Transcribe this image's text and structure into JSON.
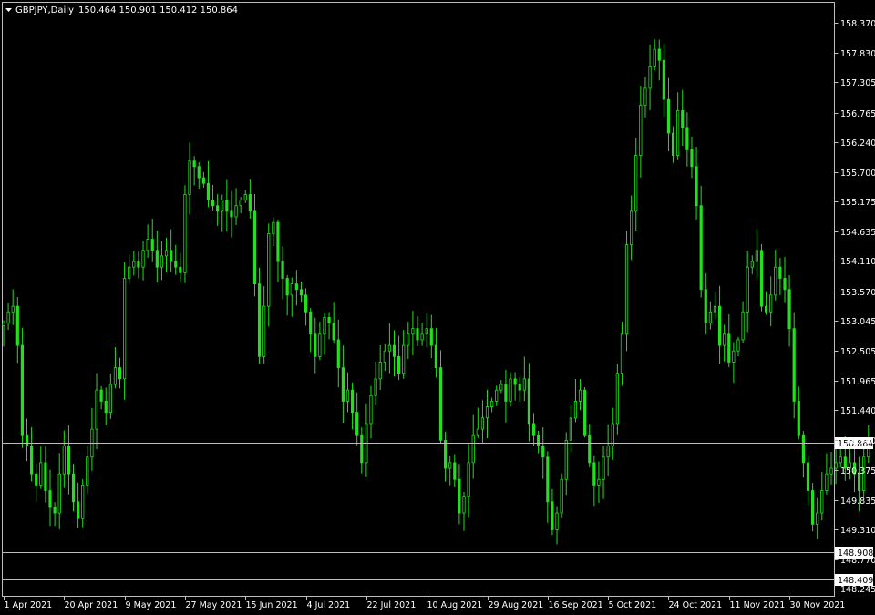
{
  "chart_data": {
    "type": "candlestick",
    "header": {
      "symbol": "GBPJPY,Daily",
      "ohlc": "150.464 150.901 150.412 150.864"
    },
    "ylim": [
      148.15,
      158.65
    ],
    "y_ticks": [
      "158.370",
      "157.830",
      "157.305",
      "156.765",
      "156.240",
      "155.700",
      "155.175",
      "154.635",
      "154.110",
      "153.570",
      "153.045",
      "152.505",
      "151.965",
      "151.440",
      "150.900",
      "150.375",
      "149.835",
      "149.310",
      "148.770",
      "148.245"
    ],
    "x_ticks": [
      {
        "label": "1 Apr 2021",
        "bar": 0
      },
      {
        "label": "20 Apr 2021",
        "bar": 13
      },
      {
        "label": "9 May 2021",
        "bar": 26
      },
      {
        "label": "27 May 2021",
        "bar": 39
      },
      {
        "label": "15 Jun 2021",
        "bar": 52
      },
      {
        "label": "4 Jul 2021",
        "bar": 65
      },
      {
        "label": "22 Jul 2021",
        "bar": 78
      },
      {
        "label": "10 Aug 2021",
        "bar": 91
      },
      {
        "label": "29 Aug 2021",
        "bar": 104
      },
      {
        "label": "16 Sep 2021",
        "bar": 117
      },
      {
        "label": "5 Oct 2021",
        "bar": 130
      },
      {
        "label": "24 Oct 2021",
        "bar": 143
      },
      {
        "label": "11 Nov 2021",
        "bar": 156
      },
      {
        "label": "30 Nov 2021",
        "bar": 169
      }
    ],
    "bar_count": 179,
    "horizontal_lines": [
      {
        "value": 150.864,
        "label": "150.864",
        "color": "#bdbdbd"
      },
      {
        "value": 148.908,
        "label": "148.908",
        "color": "#bdbdbd"
      },
      {
        "value": 148.409,
        "label": "148.409",
        "color": "#bdbdbd"
      }
    ],
    "closes": [
      153.0,
      153.2,
      153.3,
      152.6,
      151.0,
      150.8,
      150.3,
      150.1,
      150.5,
      150.0,
      149.7,
      149.6,
      150.3,
      150.8,
      150.3,
      149.8,
      149.5,
      150.1,
      150.6,
      151.1,
      151.8,
      151.6,
      151.4,
      151.9,
      152.2,
      152.0,
      153.8,
      154.0,
      154.1,
      154.0,
      154.3,
      154.5,
      154.3,
      154.0,
      154.2,
      154.3,
      154.1,
      154.0,
      153.9,
      155.3,
      155.9,
      155.8,
      155.6,
      155.5,
      155.2,
      155.1,
      155.0,
      155.2,
      155.0,
      154.9,
      155.1,
      155.2,
      155.3,
      155.0,
      153.7,
      152.4,
      153.3,
      154.6,
      154.8,
      154.1,
      153.8,
      153.5,
      153.7,
      153.6,
      153.5,
      153.2,
      152.8,
      152.4,
      152.8,
      153.1,
      153.0,
      152.7,
      152.2,
      151.6,
      151.8,
      151.4,
      151.0,
      150.5,
      151.2,
      151.7,
      152.0,
      152.3,
      152.5,
      152.6,
      152.4,
      152.1,
      152.6,
      152.8,
      152.9,
      152.7,
      152.8,
      152.9,
      152.6,
      152.2,
      150.9,
      150.4,
      150.5,
      150.2,
      149.6,
      149.9,
      150.5,
      151.0,
      151.1,
      151.3,
      151.5,
      151.6,
      151.8,
      151.9,
      151.6,
      152.0,
      151.9,
      151.8,
      152.0,
      151.2,
      151.0,
      150.8,
      150.6,
      149.8,
      149.3,
      149.6,
      150.2,
      150.9,
      151.3,
      151.6,
      151.8,
      151.0,
      150.5,
      150.1,
      150.2,
      150.6,
      150.8,
      151.2,
      152.1,
      152.8,
      154.4,
      155.0,
      156.0,
      156.9,
      157.2,
      157.6,
      157.9,
      157.7,
      157.0,
      156.4,
      156.0,
      156.8,
      156.5,
      156.1,
      155.8,
      155.1,
      153.6,
      153.0,
      153.2,
      153.3,
      152.6,
      152.8,
      152.3,
      152.5,
      152.7,
      153.2,
      154.0,
      154.1,
      154.3,
      153.3,
      153.2,
      153.5,
      154.0,
      153.8,
      153.6,
      152.9,
      151.6,
      151.0,
      150.5,
      150.0,
      149.4,
      149.6,
      150.0,
      150.3,
      150.4,
      150.5,
      150.6,
      150.4,
      150.5,
      150.3,
      150.0,
      150.6,
      150.864
    ]
  }
}
